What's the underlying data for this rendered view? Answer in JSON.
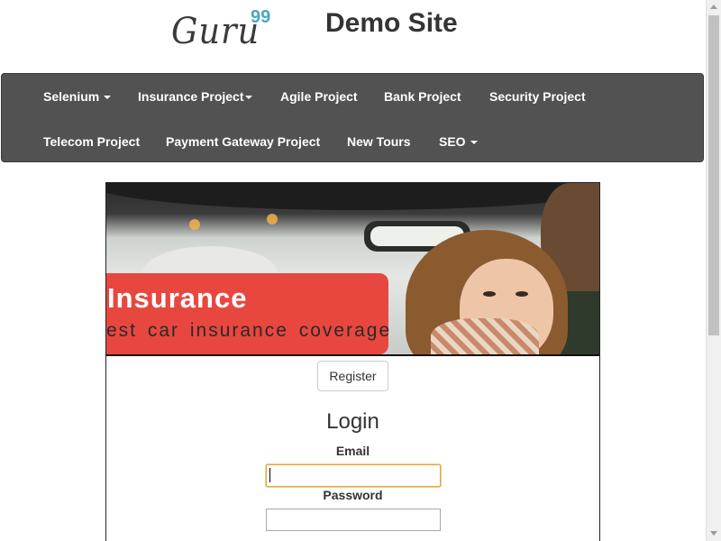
{
  "header": {
    "logo_text": "Guru",
    "logo_sup": "99",
    "site_title": "Demo Site"
  },
  "navbar": {
    "row1": [
      {
        "label": "Selenium",
        "has_caret": true
      },
      {
        "label": "Insurance Project",
        "has_caret": true
      },
      {
        "label": "Agile Project",
        "has_caret": false
      },
      {
        "label": "Bank Project",
        "has_caret": false
      },
      {
        "label": "Security Project",
        "has_caret": false
      }
    ],
    "row2": [
      {
        "label": "Telecom Project",
        "has_caret": false
      },
      {
        "label": "Payment Gateway Project",
        "has_caret": false
      },
      {
        "label": "New Tours",
        "has_caret": false
      },
      {
        "label": "SEO",
        "has_caret": true
      }
    ]
  },
  "banner": {
    "title": "Insurance",
    "subtitle": "est car insurance coverage"
  },
  "form": {
    "register_label": "Register",
    "heading": "Login",
    "email_label": "Email",
    "email_value": "",
    "password_label": "Password",
    "password_value": ""
  },
  "colors": {
    "navbar_bg": "#525252",
    "logo_accent": "#4aa6c7",
    "banner_red": "#e8473f",
    "focus_border": "#e2a43b"
  }
}
